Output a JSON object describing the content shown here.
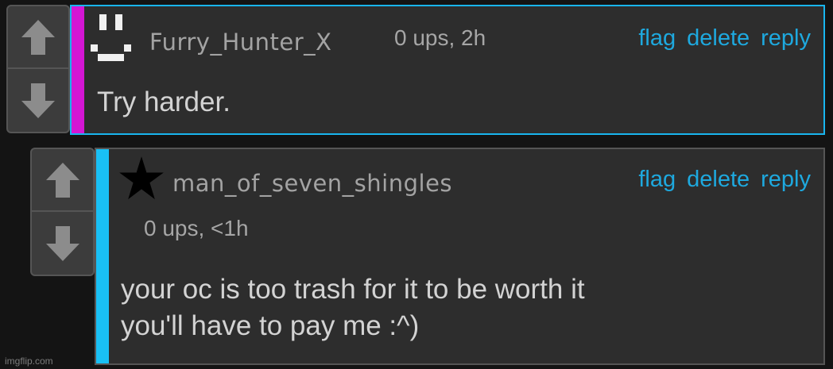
{
  "comments": [
    {
      "username": "Furry_Hunter_X",
      "meta": "0 ups, 2h",
      "text_lines": [
        "Try harder."
      ],
      "actions": {
        "flag": "flag",
        "delete": "delete",
        "reply": "reply"
      },
      "stripe_color": "#d416d4",
      "border_color": "#19b5ee",
      "avatar": "pixel-face-icon"
    },
    {
      "username": "man_of_seven_shingles",
      "meta": "0 ups, <1h",
      "text_lines": [
        "your oc is too trash for it to be worth it",
        "you'll have to pay me :^)"
      ],
      "actions": {
        "flag": "flag",
        "delete": "delete",
        "reply": "reply"
      },
      "stripe_color": "#19c0f5",
      "border_color": "#555555",
      "avatar": "star-icon"
    }
  ],
  "icons": {
    "upvote": "up-arrow-icon",
    "downvote": "down-arrow-icon"
  },
  "colors": {
    "link": "#1ea9df",
    "background": "#141414",
    "card": "#2d2d2d"
  },
  "watermark": "imgflip.com"
}
